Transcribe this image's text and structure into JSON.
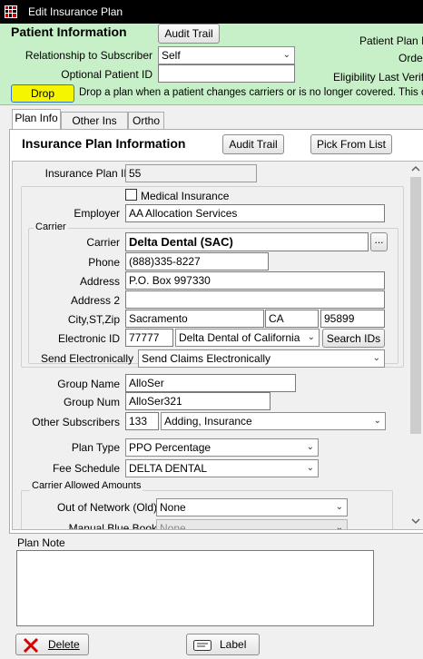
{
  "window": {
    "title": "Edit Insurance Plan"
  },
  "patient": {
    "heading": "Patient Information",
    "audit_trail_label": "Audit Trail",
    "relationship_label": "Relationship to Subscriber",
    "relationship_value": "Self",
    "optional_id_label": "Optional Patient ID",
    "optional_id_value": "",
    "plan_id_label": "Patient Plan ID",
    "order_label": "Order",
    "eligibility_label": "Eligibility Last Verified",
    "drop_label": "Drop",
    "drop_hint": "Drop a plan when a patient changes carriers or is no longer covered.  This does not"
  },
  "tabs": [
    "Plan Info",
    "Other Ins Info",
    "Ortho"
  ],
  "plan": {
    "heading": "Insurance Plan Information",
    "audit_trail_label": "Audit Trail",
    "pick_from_list_label": "Pick From List",
    "plan_id_label": "Insurance Plan ID",
    "plan_id_value": "55",
    "medical_label": "Medical Insurance",
    "employer_label": "Employer",
    "employer_value": "AA Allocation Services",
    "carrier_group_title": "Carrier",
    "carrier_label": "Carrier",
    "carrier_value": "Delta Dental (SAC)",
    "carrier_pick_label": "...",
    "phone_label": "Phone",
    "phone_value": "(888)335-8227",
    "address_label": "Address",
    "address_value": "P.O. Box 997330",
    "address2_label": "Address 2",
    "address2_value": "",
    "citystzip_label": "City,ST,Zip",
    "city_value": "Sacramento",
    "state_value": "CA",
    "zip_value": "95899",
    "electronic_id_label": "Electronic ID",
    "electronic_id_value": "77777",
    "electronic_payer_value": "Delta Dental of California",
    "search_ids_label": "Search IDs",
    "send_electronically_label": "Send Electronically",
    "send_electronically_value": "Send Claims Electronically",
    "group_name_label": "Group Name",
    "group_name_value": "AlloSer",
    "group_num_label": "Group Num",
    "group_num_value": "AlloSer321",
    "other_subscribers_label": "Other Subscribers",
    "other_subscribers_count": "133",
    "other_subscribers_value": "Adding, Insurance",
    "plan_type_label": "Plan Type",
    "plan_type_value": "PPO Percentage",
    "fee_schedule_label": "Fee Schedule",
    "fee_schedule_value": "DELTA DENTAL",
    "allowed_group_title": "Carrier Allowed Amounts",
    "out_of_network_label": "Out of Network (Old)",
    "out_of_network_value": "None",
    "manual_blue_book_label": "Manual Blue Book",
    "manual_blue_book_value": "None"
  },
  "plan_note": {
    "label": "Plan Note",
    "value": ""
  },
  "footer": {
    "delete_label": "Delete",
    "label_label": "Label"
  },
  "colors": {
    "patient_panel": "#c8f0c8",
    "drop_button": "#f5f500",
    "title_bar": "#000000"
  }
}
